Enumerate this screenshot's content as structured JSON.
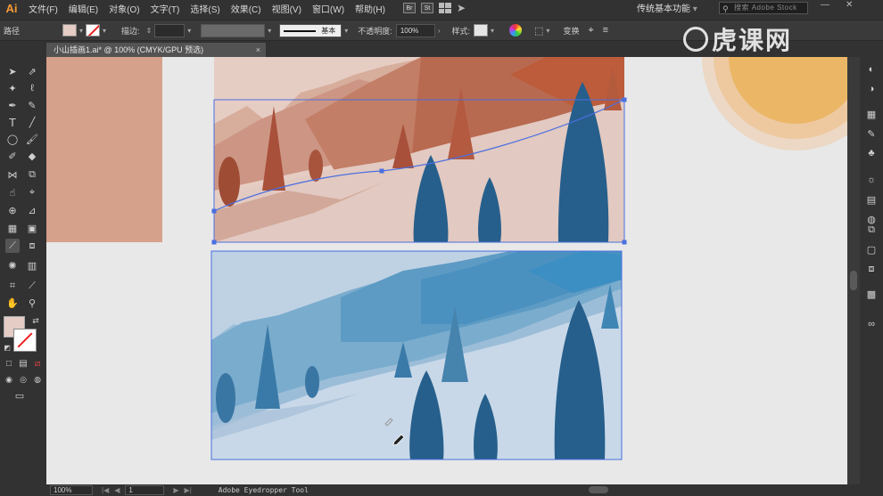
{
  "app": {
    "logo": "Ai",
    "menu": [
      "文件(F)",
      "编辑(E)",
      "对象(O)",
      "文字(T)",
      "选择(S)",
      "效果(C)",
      "视图(V)",
      "窗口(W)",
      "帮助(H)"
    ],
    "menu_icons": [
      "Br",
      "St"
    ],
    "workspace": "传统基本功能",
    "stock_search_placeholder": "搜索 Adobe Stock"
  },
  "control_bar": {
    "selection_type": "路径",
    "stroke_label": "描边:",
    "stroke_profile": "基本",
    "opacity_label": "不透明度:",
    "opacity_value": "100%",
    "style_label": "样式:",
    "transform_label": "变换"
  },
  "document": {
    "tab_title": "小山插画1.ai* @ 100% (CMYK/GPU 预选)",
    "close_glyph": "×"
  },
  "status_bar": {
    "zoom": "100%",
    "page": "1",
    "tool_name": "Adobe Eyedropper Tool"
  },
  "watermark": {
    "text": "虎课网"
  },
  "colors": {
    "fill_swatch": "#e5ccc4",
    "warm_bg": "#d6a18a",
    "sun_outer": "#ecd8c4",
    "sun_mid": "#f0c79a",
    "sun_inner": "#ebb767",
    "tree_blue": "#265f8c",
    "selection_blue": "#4a6fe0"
  },
  "icons": {
    "toolbar": [
      "selection-tool-icon",
      "direct-selection-tool-icon",
      "magic-wand-icon",
      "lasso-icon",
      "pen-tool-icon",
      "curvature-tool-icon",
      "type-tool-icon",
      "line-tool-icon",
      "ellipse-tool-icon",
      "paintbrush-icon",
      "shaper-tool-icon",
      "eraser-icon",
      "reflect-tool-icon",
      "scale-tool-icon",
      "warp-tool-icon",
      "free-transform-icon",
      "shape-builder-icon",
      "perspective-grid-icon",
      "mesh-tool-icon",
      "gradient-tool-icon",
      "eyedropper-icon",
      "blend-tool-icon",
      "symbol-sprayer-icon",
      "column-graph-icon",
      "artboard-tool-icon",
      "slice-tool-icon",
      "hand-tool-icon",
      "zoom-tool-icon"
    ],
    "right_dock": [
      "color-panel-icon",
      "color-guide-icon",
      "swatches-icon",
      "brushes-icon",
      "symbols-icon",
      "stroke-icon",
      "gradient-panel-icon",
      "transparency-icon",
      "layers-icon",
      "artboards-icon",
      "links-icon",
      "appearance-icon",
      "creative-cloud-icon"
    ]
  }
}
